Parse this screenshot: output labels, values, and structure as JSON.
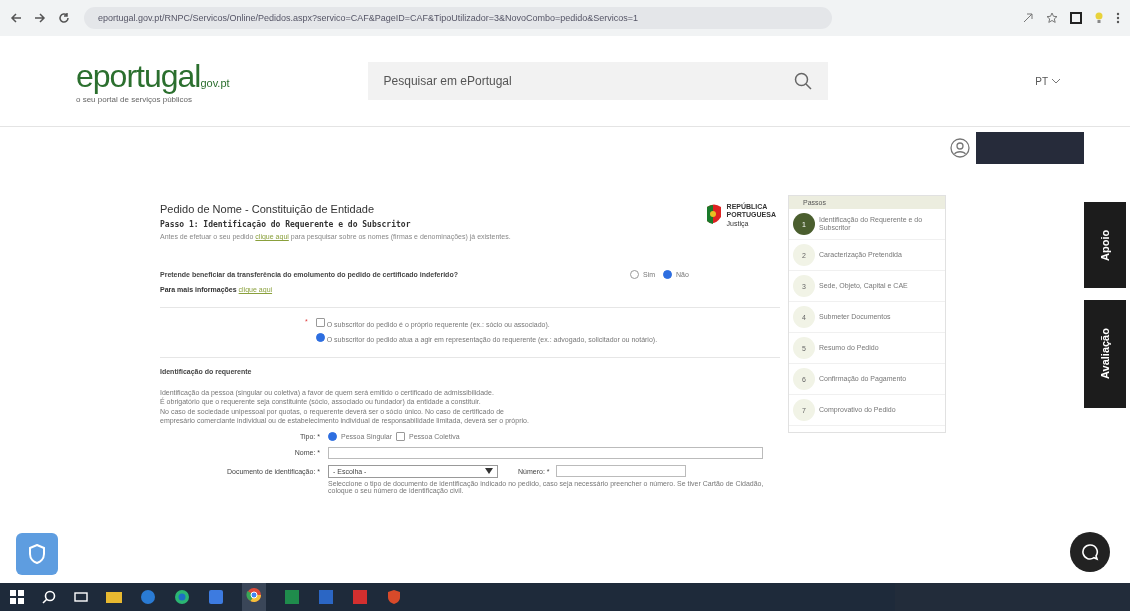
{
  "browser": {
    "url": "eportugal.gov.pt/RNPC/Servicos/Online/Pedidos.aspx?servico=CAF&PageID=CAF&TipoUtilizador=3&NovoCombo=pedido&Servicos=1"
  },
  "header": {
    "logo": "eportugal",
    "logo_suffix": "gov.pt",
    "tagline": "o seu portal de serviços públicos",
    "search": {
      "placeholder": "Pesquisar em ePortugal"
    },
    "language": "PT"
  },
  "form": {
    "title": "Pedido de Nome - Constituição de Entidade",
    "step_title": "Passo 1: Identificação do Requerente e do Subscritor",
    "intro": "Antes de efetuar o seu pedido",
    "intro_link": "clique aqui",
    "intro_end": "para pesquisar sobre os nomes (firmas e denominações) já existentes.",
    "emblem": {
      "line1": "REPÚBLICA",
      "line2": "PORTUGUESA",
      "line3": "Justiça"
    },
    "question": "Pretende beneficiar da transferência do emolumento do pedido de certificado indeferido?",
    "answers": [
      {
        "label": "Sim",
        "selected": false
      },
      {
        "label": "Não",
        "selected": true
      }
    ],
    "more_info": "Para mais informações",
    "more_info_link": "clique aqui",
    "required_mark": "*",
    "subscriber_options": [
      {
        "kind": "checkbox",
        "label": "O subscritor do pedido é o próprio requerente (ex.: sócio ou associado).",
        "selected": false
      },
      {
        "kind": "radio",
        "label": "O subscritor do pedido atua a agir em representação do requerente (ex.: advogado, solicitador ou notário).",
        "selected": true
      }
    ],
    "section_title": "Identificação do requerente",
    "section_text": [
      "Identificação da pessoa (singular ou coletiva) a favor de quem será emitido o certificado de admissibilidade.",
      "É obrigatório que o requerente seja constituinte (sócio, associado ou fundador) da entidade a constituir.",
      "No caso de sociedade unipessoal por quotas, o requerente deverá ser o sócio único. No caso de certificado de",
      "empresário comerciante individual ou de estabelecimento individual de responsabilidade limitada, deverá ser o próprio."
    ],
    "type_label": "Tipo: *",
    "types": [
      {
        "kind": "radio",
        "label": "Pessoa Singular",
        "selected": true
      },
      {
        "kind": "checkbox",
        "label": "Pessoa Coletiva",
        "selected": false
      }
    ],
    "name_label": "Nome: *",
    "doc_label": "Documento de identificação: *",
    "doc_select": "- Escolha -",
    "number_label": "Número: *",
    "doc_help": "Seleccione o tipo de documento de identificação indicado no pedido, caso seja necessário preencher o número. Se tiver Cartão de Cidadão, coloque o seu número de identificação civil."
  },
  "steps": {
    "title": "Passos",
    "items": [
      {
        "number": "1",
        "label": "Identificação do Requerente e do Subscritor",
        "selected": true
      },
      {
        "number": "2",
        "label": "Caracterização Pretendida",
        "selected": false
      },
      {
        "number": "3",
        "label": "Sede, Objeto, Capital e CAE",
        "selected": false
      },
      {
        "number": "4",
        "label": "Submeter Documentos",
        "selected": false
      },
      {
        "number": "5",
        "label": "Resumo do Pedido",
        "selected": false
      },
      {
        "number": "6",
        "label": "Confirmação do Pagamento",
        "selected": false
      },
      {
        "number": "7",
        "label": "Comprovativo do Pedido",
        "selected": false
      }
    ]
  },
  "side_tabs": [
    "Apoio",
    "Avaliação"
  ]
}
